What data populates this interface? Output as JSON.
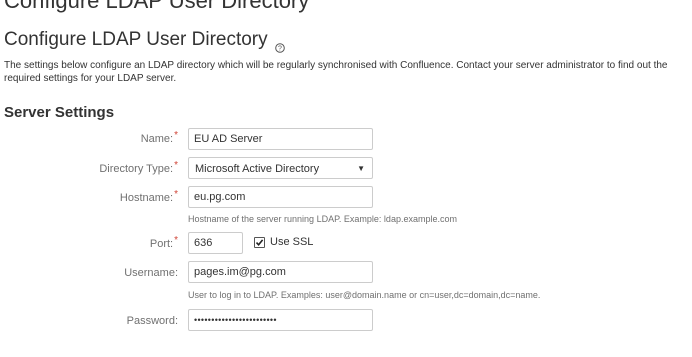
{
  "page": {
    "top_title": "Configure LDAP User Directory",
    "title": "Configure LDAP User Directory",
    "help_icon": "help-circle-icon",
    "description": "The settings below configure an LDAP directory which will be regularly synchronised with Confluence. Contact your server administrator to find out the required settings for your LDAP server."
  },
  "server_settings": {
    "heading": "Server Settings",
    "required_marker": "*",
    "name": {
      "label": "Name:",
      "value": "EU AD Server"
    },
    "directory_type": {
      "label": "Directory Type:",
      "value": "Microsoft Active Directory"
    },
    "hostname": {
      "label": "Hostname:",
      "value": "eu.pg.com",
      "hint": "Hostname of the server running LDAP. Example: ldap.example.com"
    },
    "port": {
      "label": "Port:",
      "value": "636"
    },
    "use_ssl": {
      "label": "Use SSL",
      "checked": true
    },
    "username": {
      "label": "Username:",
      "value": "pages.im@pg.com",
      "hint": "User to log in to LDAP. Examples: user@domain.name or cn=user,dc=domain,dc=name."
    },
    "password": {
      "label": "Password:",
      "value": "••••••••••••••••••••••••"
    }
  },
  "colors": {
    "text": "#333333",
    "label": "#707070",
    "required": "#d04437",
    "border": "#cccccc"
  }
}
